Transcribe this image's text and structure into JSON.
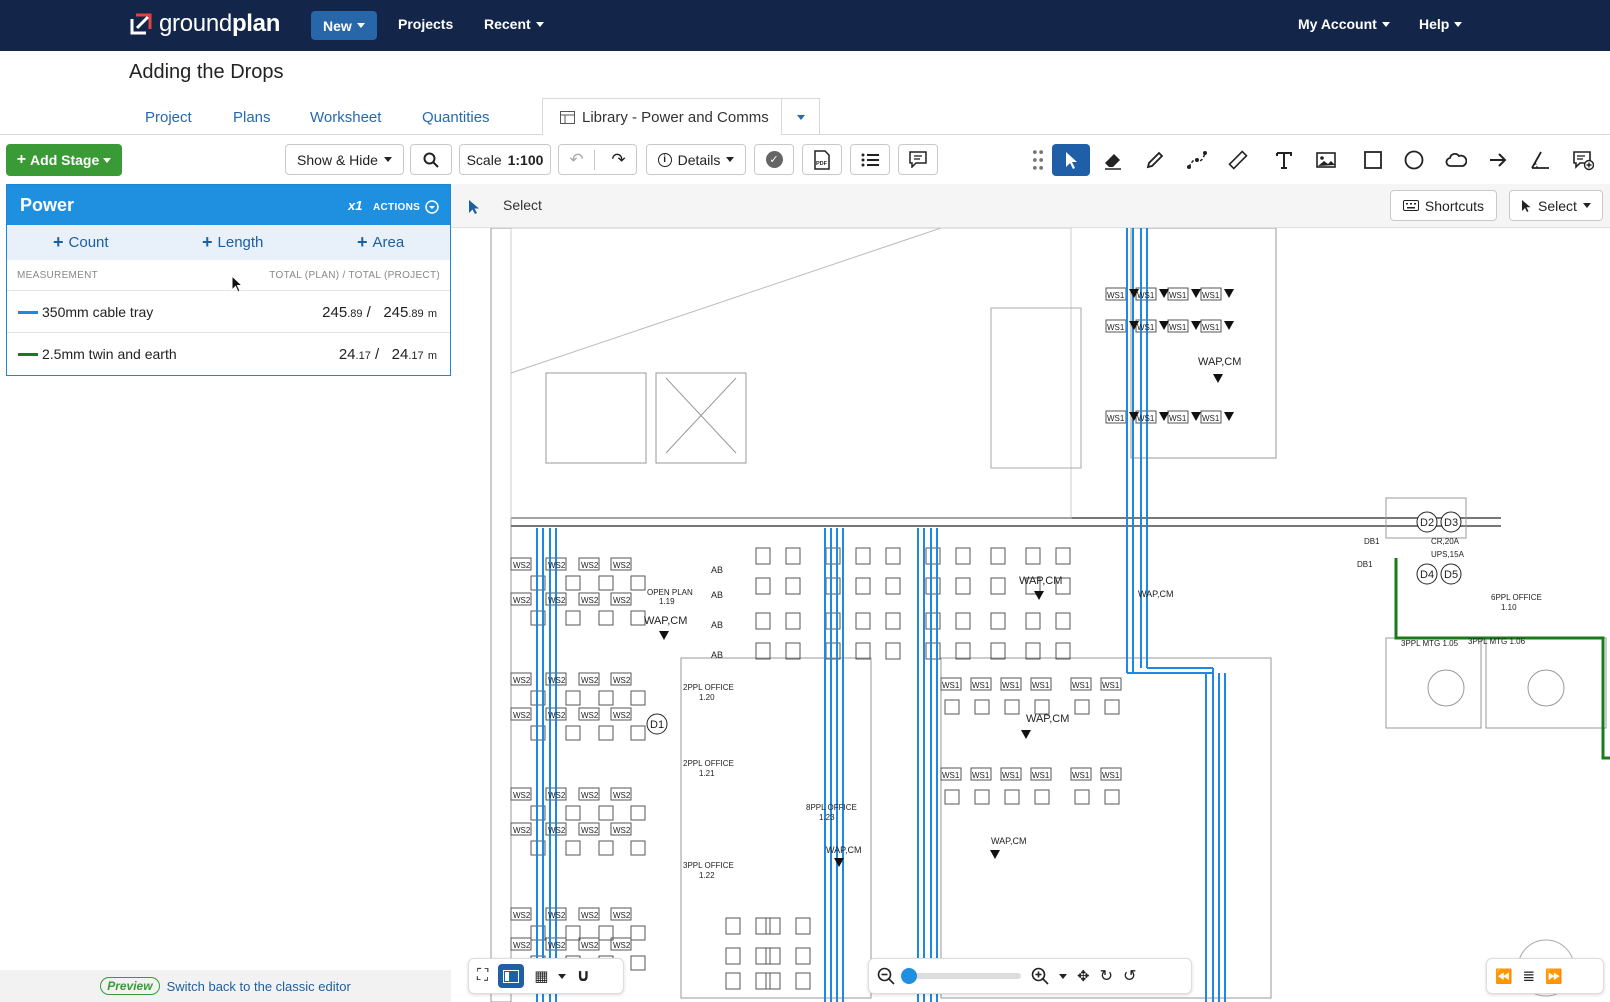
{
  "app": {
    "name_light": "ground",
    "name_bold": "plan"
  },
  "nav": {
    "new_label": "New",
    "projects_label": "Projects",
    "recent_label": "Recent",
    "account_label": "My Account",
    "help_label": "Help"
  },
  "page": {
    "title": "Adding the Drops"
  },
  "tabs": {
    "project": "Project",
    "plans": "Plans",
    "worksheet": "Worksheet",
    "quantities": "Quantities",
    "library": "Library - Power and Comms"
  },
  "toolbar": {
    "add_stage": "Add Stage",
    "show_hide": "Show & Hide",
    "scale_prefix": "Scale",
    "scale_value": "1:100",
    "details": "Details",
    "pdf_label": "PDF"
  },
  "panel": {
    "title": "Power",
    "multiplier": "x1",
    "actions": "ACTIONS",
    "add_count": "Count",
    "add_length": "Length",
    "add_area": "Area",
    "col_measurement": "MEASUREMENT",
    "col_totals": "TOTAL (PLAN) / TOTAL (PROJECT)",
    "rows": [
      {
        "name": "350mm cable tray",
        "color": "#1e88e5",
        "plan_int": "245",
        "plan_dec": ".89",
        "project_int": "245",
        "project_dec": ".89",
        "unit": "m"
      },
      {
        "name": "2.5mm twin and earth",
        "color": "#1b7a1b",
        "plan_int": "24",
        "plan_dec": ".17",
        "project_int": "24",
        "project_dec": ".17",
        "unit": "m"
      }
    ]
  },
  "canvas": {
    "mode_label": "Select",
    "shortcuts_label": "Shortcuts",
    "select_label": "Select"
  },
  "plan_labels": {
    "open_plan": "OPEN PLAN",
    "open_plan_num": "1.19",
    "wap": "WAP,CM",
    "d1": "D1",
    "d2": "D2",
    "d3": "D3",
    "d4": "D4",
    "d5": "D5",
    "office_2ppl_a": "2PPL OFFICE",
    "office_2ppl_a_num": "1.20",
    "office_2ppl_b": "2PPL OFFICE",
    "office_2ppl_b_num": "1.21",
    "office_3ppl": "3PPL OFFICE",
    "office_3ppl_num": "1.22",
    "office_8ppl": "8PPL OFFICE",
    "office_8ppl_num": "1.23",
    "office_6ppl": "6PPL OFFICE",
    "office_6ppl_num": "1.10",
    "mtg_a": "3PPL MTG 1.05",
    "mtg_b": "3PPL MTG 1.06",
    "db1": "DB1",
    "cr": "CR,20A",
    "ups": "UPS,15A",
    "ab": "AB",
    "ws1": "WS1",
    "ws2": "WS2"
  },
  "footer": {
    "preview_badge": "Preview",
    "switch_link": "Switch back to the classic editor"
  },
  "colors": {
    "nav_bg": "#13264a",
    "accent_blue": "#1f8fe0",
    "add_stage_green": "#3a9a35",
    "cable_tray": "#1e88e5",
    "twin_earth": "#1b7a1b"
  }
}
